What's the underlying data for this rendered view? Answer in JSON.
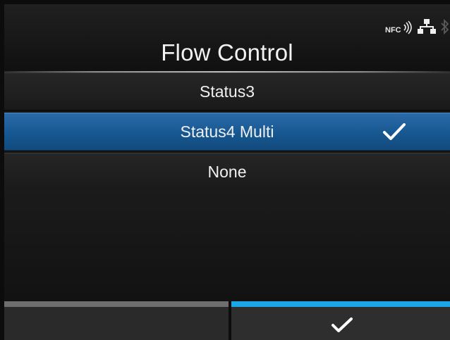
{
  "header": {
    "title": "Flow Control",
    "icons": [
      "nfc-icon",
      "network-icon",
      "bluetooth-icon"
    ]
  },
  "options": [
    {
      "label": "Status3",
      "selected": false
    },
    {
      "label": "Status4 Multi",
      "selected": true
    },
    {
      "label": "None",
      "selected": false
    }
  ],
  "footer": {
    "left_button": "",
    "right_button_icon": "check-icon"
  },
  "colors": {
    "selected_bg": "#1b5a96",
    "accent": "#1aa6e8"
  }
}
